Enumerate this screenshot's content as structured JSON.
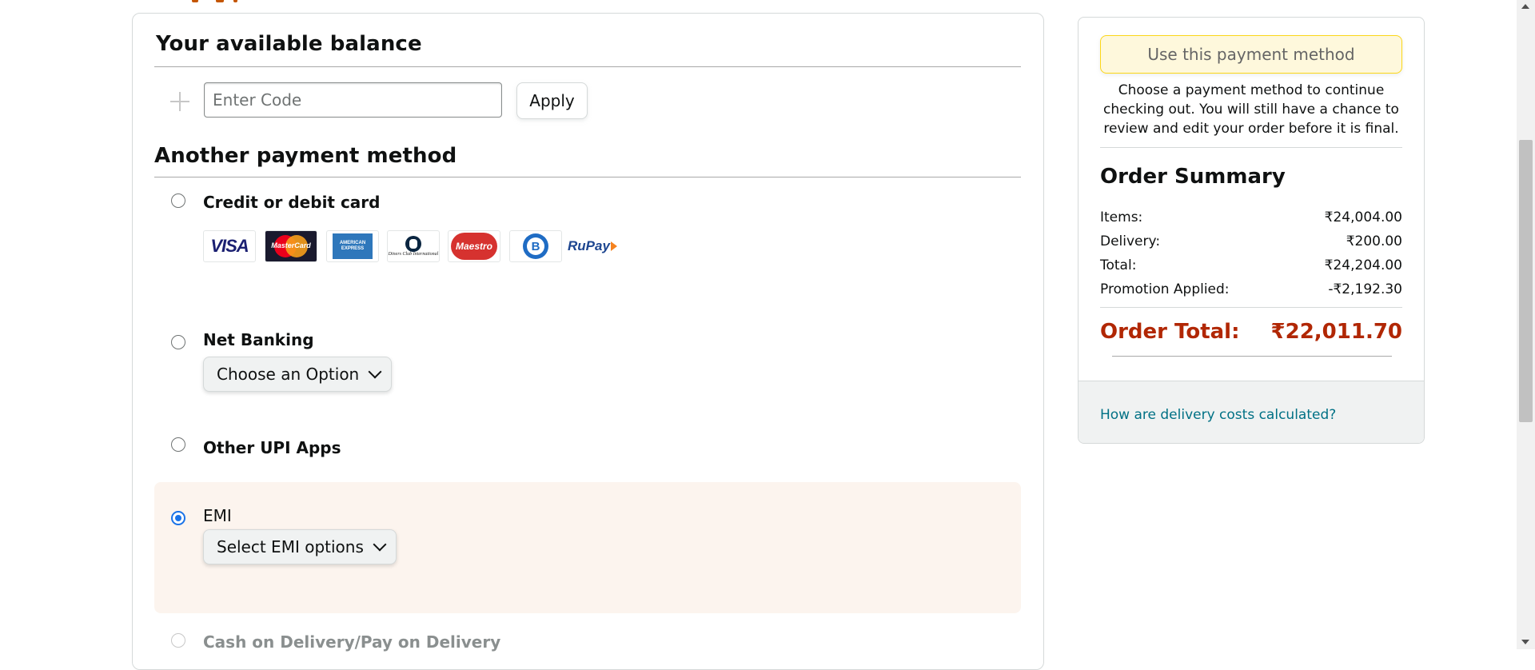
{
  "balance": {
    "title": "Your available balance",
    "code_placeholder": "Enter Code",
    "apply_label": "Apply"
  },
  "payment": {
    "title": "Another payment method",
    "options": [
      {
        "label": "Credit or debit card",
        "selected": false,
        "disabled": false
      },
      {
        "label": "Net Banking",
        "selected": false,
        "disabled": false
      },
      {
        "label": "Other UPI Apps",
        "selected": false,
        "disabled": false
      },
      {
        "label": "EMI",
        "selected": true,
        "disabled": false
      },
      {
        "label": "Cash on Delivery/Pay on Delivery",
        "selected": false,
        "disabled": true
      }
    ],
    "card_logos": [
      {
        "icon": "visa-logo-icon",
        "text": "VISA"
      },
      {
        "icon": "mastercard-logo-icon",
        "text": "MasterCard"
      },
      {
        "icon": "amex-logo-icon",
        "text": "AMERICAN EXPRESS"
      },
      {
        "icon": "diners-club-logo-icon",
        "text": "Diners Club International"
      },
      {
        "icon": "maestro-logo-icon",
        "text": "Maestro"
      },
      {
        "icon": "bajaj-finserv-logo-icon",
        "text": "B"
      },
      {
        "icon": "rupay-logo-icon",
        "text": "RuPay"
      }
    ],
    "net_banking_dropdown": "Choose an Option",
    "emi_dropdown": "Select EMI options"
  },
  "sidebar": {
    "use_button_label": "Use this payment method",
    "help_text": "Choose a payment method to continue checking out. You will still have a chance to review and edit your order before it is final.",
    "summary_title": "Order Summary",
    "rows": [
      {
        "label": "Items:",
        "value": "₹24,004.00"
      },
      {
        "label": "Delivery:",
        "value": "₹200.00"
      },
      {
        "label": "Total:",
        "value": "₹24,204.00"
      },
      {
        "label": "Promotion Applied:",
        "value": "-₹2,192.30"
      }
    ],
    "order_total_label": "Order Total:",
    "order_total_value": "₹22,011.70",
    "footer_link": "How are delivery costs calculated?"
  },
  "colors": {
    "order_total": "#b12704",
    "link": "#007185",
    "selected_radio": "#1a73e8",
    "emi_panel_bg": "#fcf4ee",
    "primary_button_bg": "#fef8d9"
  }
}
